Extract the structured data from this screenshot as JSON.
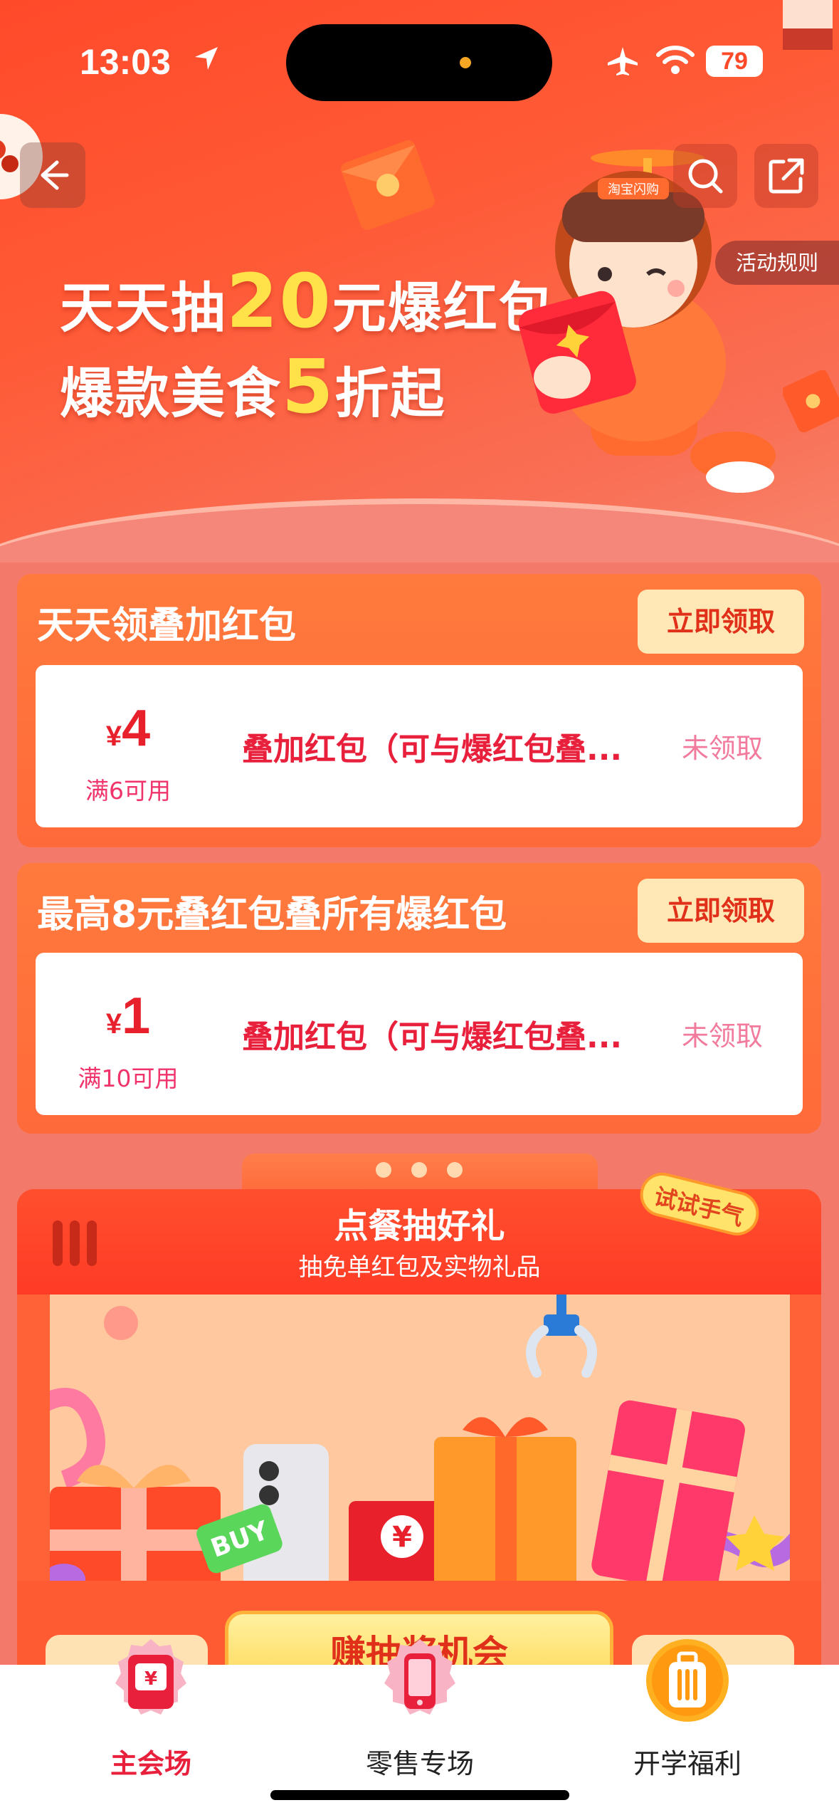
{
  "status_bar": {
    "time": "13:03",
    "battery": "79",
    "location_icon": "location-arrow-icon",
    "airplane_icon": "airplane-icon",
    "wifi_icon": "wifi-icon"
  },
  "header": {
    "back_icon": "back-arrow-icon",
    "search_icon": "search-icon",
    "share_icon": "share-icon",
    "rules_label": "活动规则"
  },
  "hero": {
    "line1_prefix": "天天抽",
    "line1_highlight": "20",
    "line1_suffix": "元爆红包",
    "line2_prefix": "爆款美食",
    "line2_highlight": "5",
    "line2_suffix": "折起",
    "mascot_badge": "淘宝闪购"
  },
  "promos": [
    {
      "title": "天天领叠加红包",
      "button": "立即领取",
      "coupon": {
        "currency": "¥",
        "amount": "4",
        "condition": "满6可用",
        "description": "叠加红包（可与爆红包叠...",
        "status": "未领取"
      }
    },
    {
      "title": "最高8元叠红包叠所有爆红包",
      "button": "立即领取",
      "coupon": {
        "currency": "¥",
        "amount": "1",
        "condition": "满10可用",
        "description": "叠加红包（可与爆红包叠...",
        "status": "未领取"
      }
    }
  ],
  "lottery": {
    "title": "点餐抽好礼",
    "subtitle": "抽免单红包及实物礼品",
    "try_badge": "试试手气",
    "earn_button": "赚抽奖机会",
    "gift_tag": "BUY",
    "red_envelope_symbol": "¥"
  },
  "tabbar": {
    "tabs": [
      {
        "label": "主会场",
        "icon": "red-envelope-icon",
        "active": true
      },
      {
        "label": "零售专场",
        "icon": "phone-icon",
        "active": false
      },
      {
        "label": "开学福利",
        "icon": "suitcase-icon",
        "active": false
      }
    ]
  },
  "colors": {
    "brand_red": "#e8203c",
    "hero_orange": "#ff4a2a",
    "highlight_yellow": "#ffe24a"
  }
}
